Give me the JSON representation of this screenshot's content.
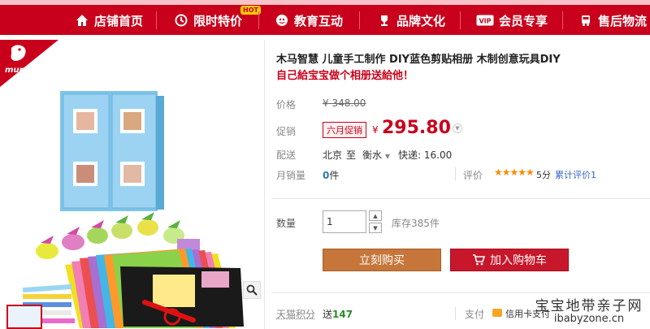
{
  "nav": {
    "items": [
      {
        "label": "店铺首页",
        "icon": "home-icon"
      },
      {
        "label": "限时特价",
        "icon": "clock-icon"
      },
      {
        "label": "教育互动",
        "icon": "education-icon"
      },
      {
        "label": "品牌文化",
        "icon": "trophy-icon"
      },
      {
        "label": "会员专享",
        "icon": "vip-icon"
      },
      {
        "label": "售后物流",
        "icon": "truck-icon"
      }
    ],
    "hot_badge": "HOT",
    "colors": {
      "nav_bg": "#c9001b",
      "accent": "#c9001b"
    }
  },
  "brand": {
    "logo_text": "muma"
  },
  "product": {
    "title": "木马智慧 儿童手工制作 DIY蓝色剪贴相册 木制创意玩具DIY",
    "subtitle": "自己給宝宝做个相册送給他！",
    "price_label": "价格",
    "original_price": "¥ 348.00",
    "promo_label": "促销",
    "promo_badge": "六月促销",
    "currency": "¥",
    "promo_price": "295.80",
    "shipping_label": "配送",
    "ship_from": "北京",
    "ship_to_word": "至",
    "ship_to": "衡水",
    "ship_fee": "快递: 16.00",
    "sales_label": "月销量",
    "sales_count": "0",
    "sales_unit": "件",
    "rating_label": "评价",
    "rating_stars": "★★★★★",
    "rating_score": "5分",
    "reviews_text": "累计评价1",
    "qty_label": "数量",
    "qty_value": "1",
    "stock_text": "库存385件",
    "buy_label": "立刻购买",
    "cart_label": "加入购物车",
    "points_label": "天猫积分",
    "points_prefix": "送",
    "points_value": "147",
    "pay_label": "支付",
    "pay_text": "信用卡支付"
  },
  "watermark": {
    "line1": "宝宝地带亲子网",
    "line2": "ibabyzone.cn"
  }
}
